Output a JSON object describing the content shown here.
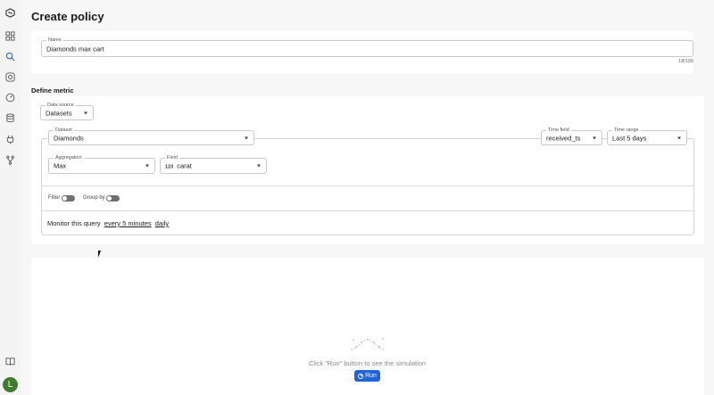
{
  "page": {
    "title": "Create policy"
  },
  "name_field": {
    "label": "Name",
    "value": "Diamonds max cart",
    "counter": "18/100"
  },
  "define_metric": {
    "title": "Define metric",
    "data_source": {
      "label": "Data source",
      "value": "Datasets"
    },
    "dataset": {
      "label": "Dataset",
      "value": "Diamonds"
    },
    "time_field": {
      "label": "Time field",
      "value": "received_ts"
    },
    "time_range": {
      "label": "Time range",
      "value": "Last 5 days"
    },
    "aggregation": {
      "label": "Aggregation",
      "value": "Max"
    },
    "field": {
      "label": "Field",
      "type_badge": "123",
      "value": "carat"
    },
    "filter": {
      "label": "Filter",
      "enabled": false
    },
    "group_by": {
      "label": "Group by",
      "enabled": false
    },
    "monitor": {
      "prefix": "Monitor this query",
      "frequency": "every 5 minutes",
      "schedule": "daily"
    }
  },
  "simulation": {
    "hint": "Click \"Run\" button to see the simulation",
    "run_label": "Run"
  },
  "user": {
    "avatar_initial": "L",
    "avatar_color": "#3f7d2e"
  },
  "colors": {
    "primary": "#1f64d8"
  }
}
